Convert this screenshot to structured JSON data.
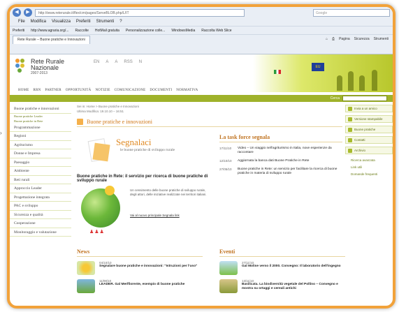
{
  "browser": {
    "address": "http://www.reterurale.it/flex/cm/pages/ServeBLOB.php/L/IT",
    "search_placeholder": "Google",
    "menu": [
      "File",
      "Modifica",
      "Visualizza",
      "Preferiti",
      "Strumenti",
      "?"
    ],
    "favorites_label": "Preferiti",
    "favorites": [
      "http://www.agraria.org/...",
      "Raccolte",
      "HotMail gratuita",
      "Personalizzazione colle...",
      "WindowsMedia",
      "Raccolta Web Slice"
    ],
    "tab_title": "Rete Rurale – Buone pratiche e Innovazioni",
    "tools": [
      "Pagina",
      "Sicurezza",
      "Strumenti"
    ]
  },
  "site": {
    "logo_line1": "Rete Rurale",
    "logo_line2": "Nazionale",
    "logo_years": "2007-2013",
    "header_icons": [
      "EN",
      "A",
      "A",
      "RSS",
      "N"
    ],
    "topnav": [
      "HOME",
      "RRN",
      "PARTNER",
      "OPPORTUNITÀ",
      "NOTIZIE",
      "COMUNICAZIONE",
      "DOCUMENTI",
      "NORMATIVA"
    ],
    "search_label": "Cerca",
    "eu_label": "EU"
  },
  "leftnav": {
    "items": [
      {
        "label": "Buone pratiche e innovazioni"
      },
      {
        "label": "Programmazione"
      },
      {
        "label": "Regioni"
      },
      {
        "label": "Agriturismo"
      },
      {
        "label": "Donne e Impresa"
      },
      {
        "label": "Paesaggio"
      },
      {
        "label": "Ambiente"
      },
      {
        "label": "Reti rurali"
      },
      {
        "label": "Approccio Leader"
      },
      {
        "label": "Progettazione integrata"
      },
      {
        "label": "PAC e sviluppo"
      },
      {
        "label": "Sicurezza e qualità"
      },
      {
        "label": "Cooperazione"
      },
      {
        "label": "Monitoraggio e valutazione"
      }
    ],
    "subitems": [
      "Buone pratiche Leader",
      "Buone pratiche in Rete"
    ]
  },
  "main": {
    "breadcrumb": "Sei in: Home > Buone pratiche e Innovazioni",
    "updated": "Ultima Modifica: 19.10.10 – 16:51",
    "title": "Buone pratiche e innovazioni",
    "segnalaci_title": "Segnalaci",
    "segnalaci_sub": "le buone pratiche di sviluppo rurale",
    "bp_heading": "Buone pratiche in Rete: il servizio per ricerca di buone pratiche di sviluppo rurale",
    "bp_text": "Un censimento delle buone pratiche di sviluppo rurale, degli attori, delle iniziative realizzate nei territori italiani.",
    "bp_link": "Vai al nuovo principale Segnala link",
    "taskforce_title": "La task force segnala",
    "taskforce": [
      {
        "date": "17/11/10",
        "title": "Video – Un viaggio nell'agriturismo in Italia, nove esperienze da raccontare"
      },
      {
        "date": "12/10/10",
        "title": "Aggiornata la banca dati Buone Pratiche in Rete"
      },
      {
        "date": "27/05/10",
        "title": "Buone pratiche in Rete: un servizio per facilitare la ricerca di buone pratiche in materia di sviluppo rurale"
      }
    ],
    "news_title": "News",
    "news": [
      {
        "date": "04/10/10",
        "title": "Segnalare buone pratiche e innovazioni: \"Istruzioni per l'uso\""
      },
      {
        "date": "11/08/10",
        "title": "LEADER. Gal Merlfiorente, esempio di buone pratiche"
      }
    ],
    "events_title": "Eventi",
    "events": [
      {
        "date": "27/11/10",
        "title": "Gal Molise verso il 2000. Convegno: Il laboratorio dell'ingegno"
      },
      {
        "date": "13/11/10",
        "title": "Basilicata. La biodiversità vegetale del Pollino – Convegno e mostra su ortaggi e cereali antichi"
      }
    ]
  },
  "rightbar": {
    "buttons": [
      "Invia a un amico",
      "Versione stampabile",
      "Buone pratiche",
      "Contatti",
      "Archivio"
    ],
    "links": [
      "Ricerca avanzata",
      "Link utili",
      "Domande frequenti"
    ]
  },
  "colors": {
    "frame": "#f2a23a",
    "accent_green": "#9fb22a",
    "title_orange": "#d07818"
  }
}
